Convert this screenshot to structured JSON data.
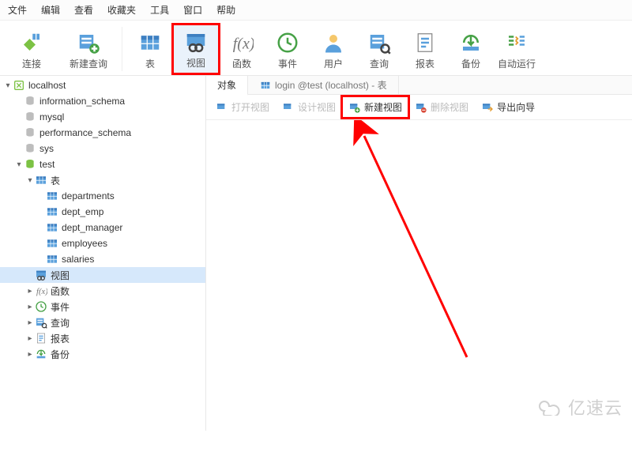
{
  "menu": [
    "文件",
    "编辑",
    "查看",
    "收藏夹",
    "工具",
    "窗口",
    "帮助"
  ],
  "toolbar": [
    {
      "name": "connect",
      "label": "连接",
      "icon": "plug"
    },
    {
      "name": "newquery",
      "label": "新建查询",
      "icon": "newquery"
    },
    {
      "sep": true
    },
    {
      "name": "table",
      "label": "表",
      "icon": "table"
    },
    {
      "name": "view",
      "label": "视图",
      "icon": "view",
      "selected": true,
      "redbox": true
    },
    {
      "name": "func",
      "label": "函数",
      "icon": "fx"
    },
    {
      "name": "event",
      "label": "事件",
      "icon": "clock"
    },
    {
      "name": "user",
      "label": "用户",
      "icon": "user"
    },
    {
      "name": "query",
      "label": "查询",
      "icon": "query"
    },
    {
      "name": "report",
      "label": "报表",
      "icon": "report"
    },
    {
      "name": "backup",
      "label": "备份",
      "icon": "backup"
    },
    {
      "name": "autorun",
      "label": "自动运行",
      "icon": "autorun"
    }
  ],
  "tree": [
    {
      "d": 0,
      "arrow": "▾",
      "icon": "conn-green",
      "label": "localhost"
    },
    {
      "d": 1,
      "arrow": "",
      "icon": "db",
      "label": "information_schema"
    },
    {
      "d": 1,
      "arrow": "",
      "icon": "db",
      "label": "mysql"
    },
    {
      "d": 1,
      "arrow": "",
      "icon": "db",
      "label": "performance_schema"
    },
    {
      "d": 1,
      "arrow": "",
      "icon": "db",
      "label": "sys"
    },
    {
      "d": 1,
      "arrow": "▾",
      "icon": "db-green",
      "label": "test"
    },
    {
      "d": 2,
      "arrow": "▾",
      "icon": "table",
      "label": "表"
    },
    {
      "d": 3,
      "arrow": "",
      "icon": "table",
      "label": "departments"
    },
    {
      "d": 3,
      "arrow": "",
      "icon": "table",
      "label": "dept_emp"
    },
    {
      "d": 3,
      "arrow": "",
      "icon": "table",
      "label": "dept_manager"
    },
    {
      "d": 3,
      "arrow": "",
      "icon": "table",
      "label": "employees"
    },
    {
      "d": 3,
      "arrow": "",
      "icon": "table",
      "label": "salaries"
    },
    {
      "d": 2,
      "arrow": "",
      "icon": "view",
      "label": "视图",
      "selected": true
    },
    {
      "d": 2,
      "arrow": "▸",
      "icon": "fx",
      "label": "函数"
    },
    {
      "d": 2,
      "arrow": "▸",
      "icon": "clock",
      "label": "事件"
    },
    {
      "d": 2,
      "arrow": "▸",
      "icon": "query",
      "label": "查询"
    },
    {
      "d": 2,
      "arrow": "▸",
      "icon": "report",
      "label": "报表"
    },
    {
      "d": 2,
      "arrow": "▸",
      "icon": "backup",
      "label": "备份"
    }
  ],
  "tabs": [
    {
      "label": "对象",
      "active": true,
      "icon": null
    },
    {
      "label": "login @test (localhost) - 表",
      "active": false,
      "icon": "table"
    }
  ],
  "subtoolbar": [
    {
      "label": "打开视图",
      "dim": true,
      "icon": "view-open"
    },
    {
      "label": "设计视图",
      "dim": true,
      "icon": "view-design"
    },
    {
      "label": "新建视图",
      "dim": false,
      "red": true,
      "icon": "view-new"
    },
    {
      "label": "删除视图",
      "dim": true,
      "icon": "view-del"
    },
    {
      "label": "导出向导",
      "dim": false,
      "icon": "export"
    }
  ],
  "watermark": "亿速云"
}
